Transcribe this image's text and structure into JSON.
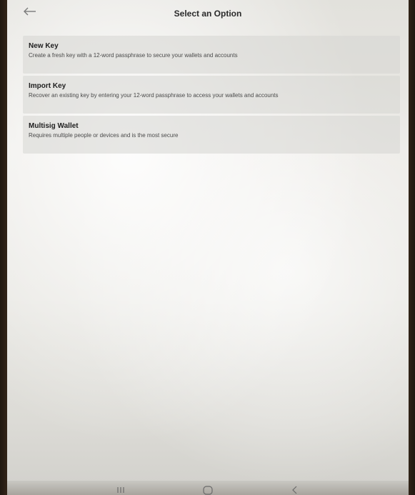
{
  "header": {
    "back_icon": "arrow-left-icon",
    "title": "Select an Option"
  },
  "options": [
    {
      "title": "New Key",
      "description": "Create a fresh key with a 12-word passphrase to secure your wallets and accounts"
    },
    {
      "title": "Import Key",
      "description": "Recover an existing key by entering your 12-word passphrase to access your wallets and accounts"
    },
    {
      "title": "Multisig Wallet",
      "description": "Requires multiple people or devices and is the most secure"
    }
  ],
  "navigation_bar": {
    "recents_icon": "recents-icon",
    "home_icon": "home-icon",
    "back_icon": "back-chevron-icon"
  },
  "colors": {
    "screen_background": "#e8e7e2",
    "card_background": "#d6d5d1",
    "title_text": "#2a2a2a",
    "description_text": "#4a4a4a"
  }
}
